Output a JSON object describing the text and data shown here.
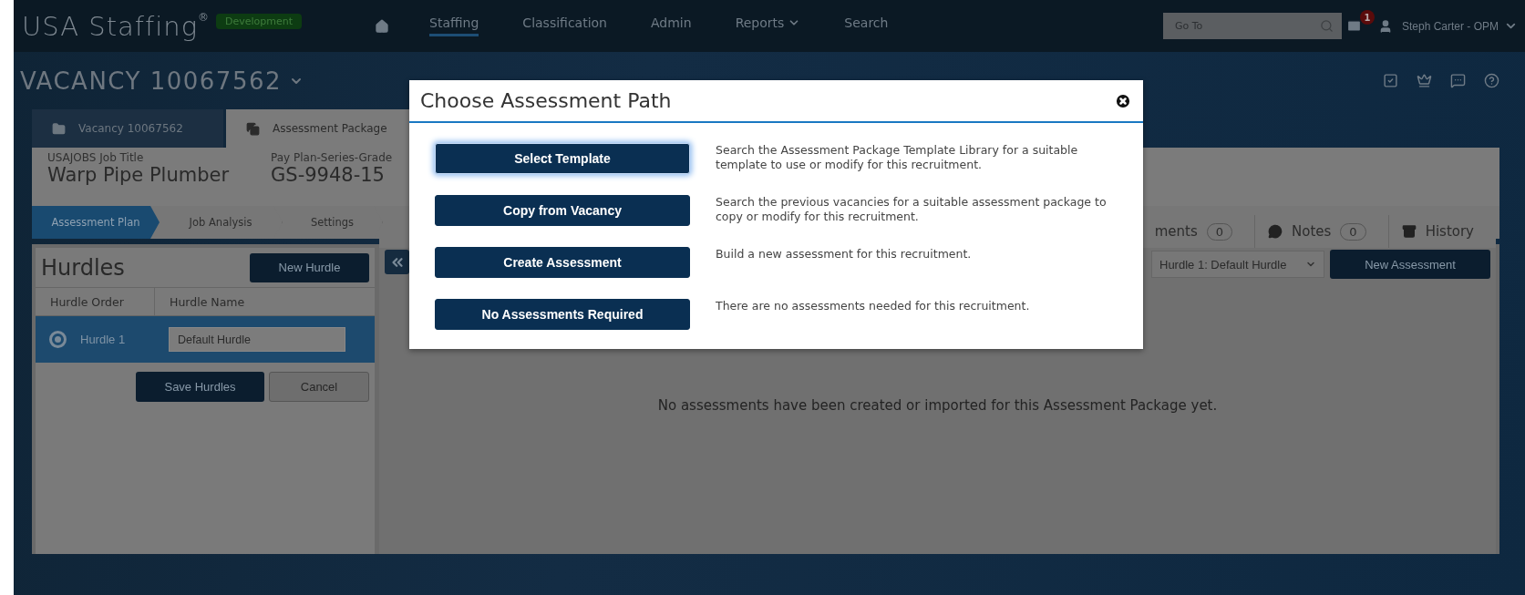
{
  "header": {
    "logo": "USA Staffing",
    "logo_mark": "®",
    "environment": "Development",
    "nav": [
      {
        "label": "Staffing",
        "selected": true,
        "dropdown": false
      },
      {
        "label": "Classification",
        "selected": false,
        "dropdown": false
      },
      {
        "label": "Admin",
        "selected": false,
        "dropdown": false
      },
      {
        "label": "Reports",
        "selected": false,
        "dropdown": true
      },
      {
        "label": "Search",
        "selected": false,
        "dropdown": false
      }
    ],
    "goto": {
      "placeholder": "Go To"
    },
    "messages_badge": "1",
    "user": "Steph Carter - OPM"
  },
  "vacancy": {
    "title": "VACANCY 10067562"
  },
  "tabs": [
    {
      "label": "Vacancy 10067562",
      "selected": false
    },
    {
      "label": "Assessment Package",
      "selected": true
    }
  ],
  "job": [
    {
      "label": "USAJOBS Job Title",
      "value": "Warp Pipe Plumber"
    },
    {
      "label": "Pay Plan-Series-Grade",
      "value": "GS-9948-15"
    }
  ],
  "steps": [
    {
      "label": "Assessment Plan",
      "selected": true
    },
    {
      "label": "Job Analysis",
      "selected": false
    },
    {
      "label": "Settings",
      "selected": false
    }
  ],
  "hurdles": {
    "title": "Hurdles",
    "new_button": "New Hurdle",
    "columns": [
      "Hurdle Order",
      "Hurdle Name"
    ],
    "rows": [
      {
        "order": "Hurdle 1",
        "name": "Default Hurdle",
        "selected": true
      }
    ],
    "save_button": "Save Hurdles",
    "cancel_button": "Cancel"
  },
  "assessments": {
    "tabs": [
      {
        "label": "ments",
        "count": "0"
      },
      {
        "label": "Notes",
        "count": "0"
      },
      {
        "label": "History"
      }
    ],
    "hurdle_select": "Hurdle 1: Default Hurdle",
    "new_button": "New Assessment",
    "empty_message": "No assessments have been created or imported for this Assessment Package yet."
  },
  "dialog": {
    "title": "Choose Assessment Path",
    "options": [
      {
        "button": "Select Template",
        "description": "Search the Assessment Package Template Library for a suitable template to use or modify for this recruitment.",
        "focused": true
      },
      {
        "button": "Copy from Vacancy",
        "description": "Search the previous vacancies for a suitable assessment package to copy or modify for this recruitment.",
        "focused": false
      },
      {
        "button": "Create Assessment",
        "description": "Build a new assessment for this recruitment.",
        "focused": false
      },
      {
        "button": "No Assessments Required",
        "description": "There are no assessments needed for this recruitment.",
        "focused": false
      }
    ]
  }
}
